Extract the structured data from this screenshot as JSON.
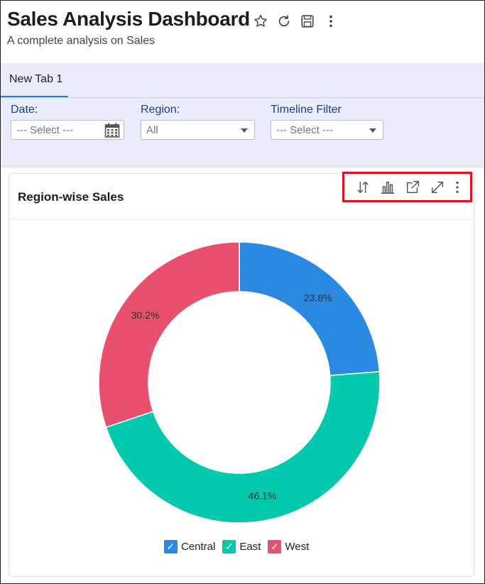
{
  "header": {
    "title": "Sales Analysis Dashboard",
    "subtitle": "A complete analysis on Sales",
    "icons": [
      "star-icon",
      "refresh-icon",
      "save-icon",
      "more-vertical-icon"
    ]
  },
  "tabs": [
    {
      "label": "New Tab 1",
      "active": true
    }
  ],
  "filters": {
    "date": {
      "label": "Date:",
      "value": "--- Select ---",
      "icon": "calendar-icon"
    },
    "region": {
      "label": "Region:",
      "value": "All"
    },
    "timeline": {
      "label": "Timeline Filter",
      "value": "--- Select ---"
    }
  },
  "card": {
    "title": "Region-wise Sales",
    "toolbar": [
      "sort-icon",
      "bar-chart-icon",
      "open-new-icon",
      "expand-icon",
      "more-vertical-icon"
    ]
  },
  "chart_data": {
    "type": "pie",
    "variant": "donut",
    "title": "Region-wise Sales",
    "categories": [
      "Central",
      "East",
      "West"
    ],
    "values": [
      23.8,
      46.1,
      30.2
    ],
    "value_labels": [
      "23.8%",
      "46.1%",
      "30.2%"
    ],
    "colors": [
      "#2b89e2",
      "#02c9ad",
      "#e8506e"
    ],
    "legend": [
      "Central",
      "East",
      "West"
    ],
    "legend_position": "bottom"
  },
  "colors": {
    "accent": "#2d7be0",
    "filter_label": "#1f3c88",
    "band_bg": "#e8ecfb",
    "highlight_border": "#e0101a"
  }
}
